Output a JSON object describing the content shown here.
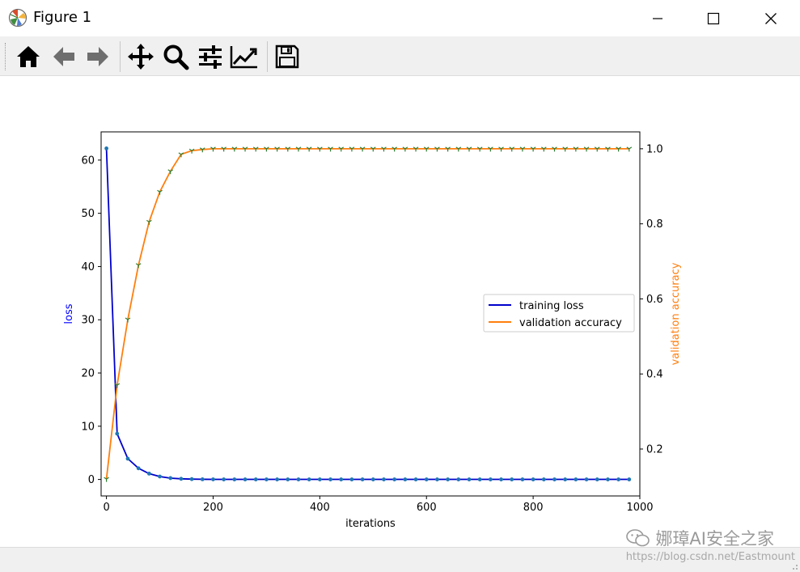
{
  "window": {
    "title": "Figure 1",
    "colors": {
      "titlebar": "#ffffff",
      "toolbar": "#f0f0f0"
    }
  },
  "toolbar": {
    "buttons": [
      {
        "name": "home-button",
        "icon": "home-icon"
      },
      {
        "name": "back-button",
        "icon": "arrow-left-icon"
      },
      {
        "name": "forward-button",
        "icon": "arrow-right-icon"
      },
      {
        "name": "pan-button",
        "icon": "move-icon"
      },
      {
        "name": "zoom-button",
        "icon": "magnifier-icon"
      },
      {
        "name": "subplots-button",
        "icon": "sliders-icon"
      },
      {
        "name": "edit-axis-button",
        "icon": "line-chart-icon"
      },
      {
        "name": "save-button",
        "icon": "floppy-disk-icon"
      }
    ]
  },
  "watermark": {
    "wechat": "娜璋AI安全之家",
    "url": "https://blog.csdn.net/Eastmount"
  },
  "chart_data": {
    "type": "line",
    "xlabel": "iterations",
    "ylabel_left": "loss",
    "ylabel_right": "validation accuracy",
    "xlim": [
      -10,
      1000
    ],
    "ylim_left": [
      -3.1,
      65.3
    ],
    "ylim_right": [
      0.075,
      1.045
    ],
    "xticks": [
      0,
      200,
      400,
      600,
      800,
      1000
    ],
    "yticks_left": [
      0,
      10,
      20,
      30,
      40,
      50,
      60
    ],
    "yticks_right": [
      0.2,
      0.4,
      0.6,
      0.8,
      1.0
    ],
    "ytick_labels_right": [
      "0.2",
      "0.4",
      "0.6",
      "0.8",
      "1.0"
    ],
    "grid": false,
    "legend_placement": "center-right",
    "colors": {
      "loss_line": "#0000cc",
      "loss_marker": "#1f77b4",
      "accuracy_line": "#ff7f0e",
      "accuracy_marker": "#2e7d32",
      "left_label": "#0000ff",
      "right_label": "#ff7f0e"
    },
    "series": [
      {
        "name": "training loss",
        "axis": "left",
        "x": [
          0,
          20,
          40,
          60,
          80,
          100,
          120,
          140,
          160,
          180,
          200,
          220,
          240,
          260,
          280,
          300,
          320,
          340,
          360,
          380,
          400,
          420,
          440,
          460,
          480,
          500,
          520,
          540,
          560,
          580,
          600,
          620,
          640,
          660,
          680,
          700,
          720,
          740,
          760,
          780,
          800,
          820,
          840,
          860,
          880,
          900,
          920,
          940,
          960,
          980
        ],
        "values": [
          62.2,
          8.6,
          3.9,
          2.1,
          1.1,
          0.55,
          0.25,
          0.12,
          0.06,
          0.03,
          0.02,
          0.01,
          0.01,
          0.01,
          0.01,
          0.01,
          0.01,
          0.01,
          0.01,
          0.01,
          0.01,
          0.01,
          0.01,
          0.01,
          0.01,
          0.01,
          0.01,
          0.01,
          0.01,
          0.01,
          0.01,
          0.01,
          0.01,
          0.01,
          0.01,
          0.01,
          0.01,
          0.01,
          0.01,
          0.01,
          0.01,
          0.01,
          0.01,
          0.01,
          0.01,
          0.01,
          0.01,
          0.01,
          0.01,
          0.01
        ]
      },
      {
        "name": "validation accuracy",
        "axis": "right",
        "x": [
          0,
          20,
          40,
          60,
          80,
          100,
          120,
          140,
          160,
          180,
          200,
          220,
          240,
          260,
          280,
          300,
          320,
          340,
          360,
          380,
          400,
          420,
          440,
          460,
          480,
          500,
          520,
          540,
          560,
          580,
          600,
          620,
          640,
          660,
          680,
          700,
          720,
          740,
          760,
          780,
          800,
          820,
          840,
          860,
          880,
          900,
          920,
          940,
          960,
          980
        ],
        "values": [
          0.12,
          0.37,
          0.545,
          0.69,
          0.805,
          0.885,
          0.94,
          0.985,
          0.995,
          0.998,
          1.0,
          1.0,
          1.0,
          1.0,
          1.0,
          1.0,
          1.0,
          1.0,
          1.0,
          1.0,
          1.0,
          1.0,
          1.0,
          1.0,
          1.0,
          1.0,
          1.0,
          1.0,
          1.0,
          1.0,
          1.0,
          1.0,
          1.0,
          1.0,
          1.0,
          1.0,
          1.0,
          1.0,
          1.0,
          1.0,
          1.0,
          1.0,
          1.0,
          1.0,
          1.0,
          1.0,
          1.0,
          1.0,
          1.0,
          1.0
        ]
      }
    ]
  }
}
